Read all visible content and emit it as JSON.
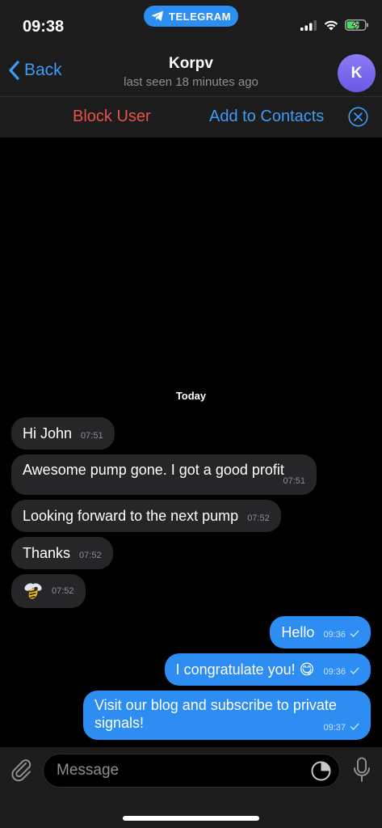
{
  "status": {
    "time": "09:38",
    "app_pill": "TELEGRAM",
    "icons": [
      "signal-icon",
      "wifi-icon",
      "battery-charging-icon"
    ]
  },
  "header": {
    "back_label": "Back",
    "title": "Korpv",
    "subtitle": "last seen 18 minutes ago",
    "avatar_letter": "K"
  },
  "actions": {
    "block_label": "Block User",
    "add_label": "Add to Contacts"
  },
  "chat": {
    "date_label": "Today",
    "incoming": [
      {
        "text": "Hi John",
        "time": "07:51"
      },
      {
        "text": "Awesome pump gone. I got a good profit",
        "time": "07:51"
      },
      {
        "text": "Looking forward to the next pump",
        "time": "07:52"
      },
      {
        "text": "Thanks",
        "time": "07:52"
      },
      {
        "text": "",
        "sticker": "bee-emoji",
        "time": "07:52"
      }
    ],
    "outgoing": [
      {
        "text": "Hello",
        "time": "09:36"
      },
      {
        "text": "I congratulate you! 😋",
        "time": "09:36"
      },
      {
        "text": "Visit our blog and subscribe to private signals!",
        "time": "09:37"
      }
    ]
  },
  "input": {
    "placeholder": "Message"
  },
  "colors": {
    "accent": "#3e9bf6",
    "danger": "#e8524a",
    "bubble_out": "#2d8df3",
    "bubble_in": "#262628"
  }
}
